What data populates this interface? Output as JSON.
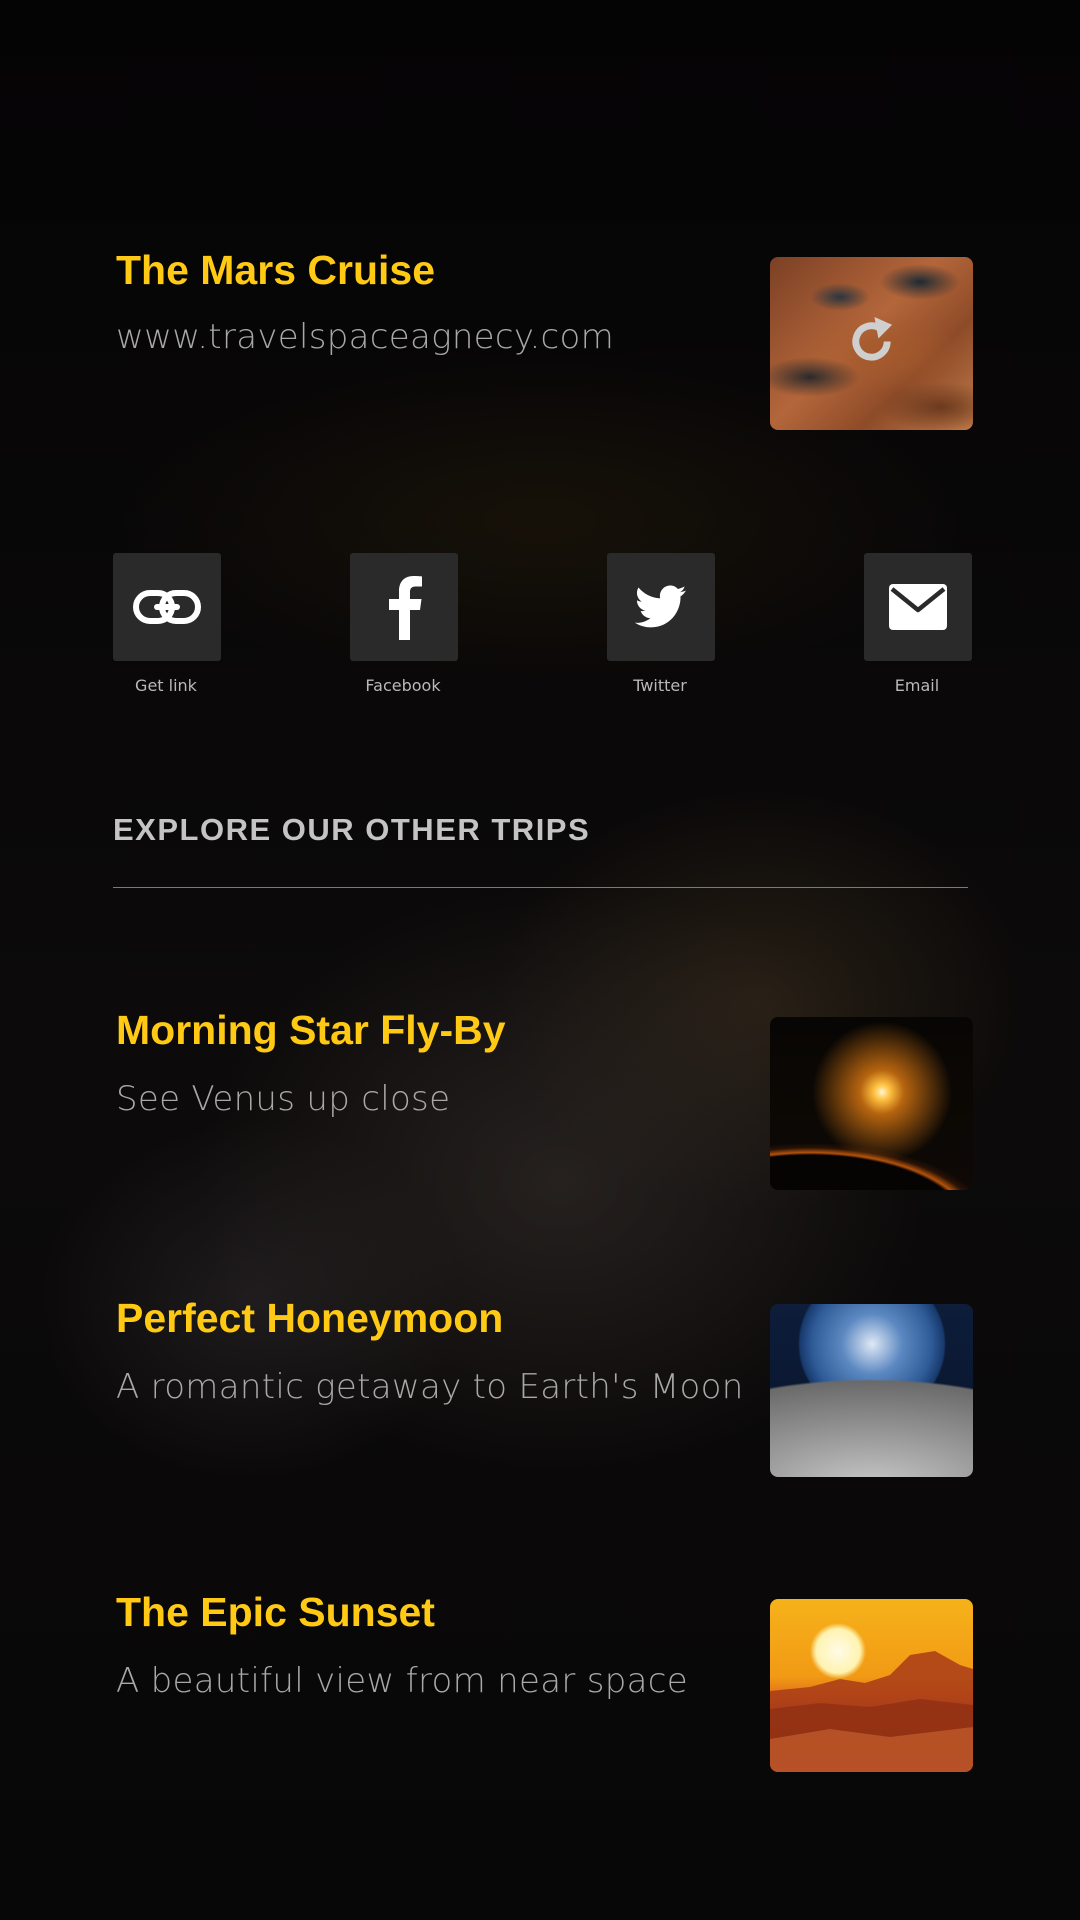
{
  "current_trip": {
    "title": "The Mars Cruise",
    "url": "www.travelspaceagnecy.com"
  },
  "share_options": [
    {
      "label": "Get link",
      "icon": "link-icon"
    },
    {
      "label": "Facebook",
      "icon": "facebook-icon"
    },
    {
      "label": "Twitter",
      "icon": "twitter-icon"
    },
    {
      "label": "Email",
      "icon": "email-icon"
    }
  ],
  "section": {
    "title": "EXPLORE OUR OTHER TRIPS"
  },
  "trips": [
    {
      "title": "Morning Star Fly-By",
      "subtitle": "See Venus up close"
    },
    {
      "title": "Perfect Honeymoon",
      "subtitle": "A romantic getaway to Earth's Moon"
    },
    {
      "title": "The Epic Sunset",
      "subtitle": "A beautiful view from near space"
    }
  ],
  "colors": {
    "accent": "#ffc914",
    "subtitle": "#a8a8a8",
    "tile": "#2a2a2a"
  }
}
